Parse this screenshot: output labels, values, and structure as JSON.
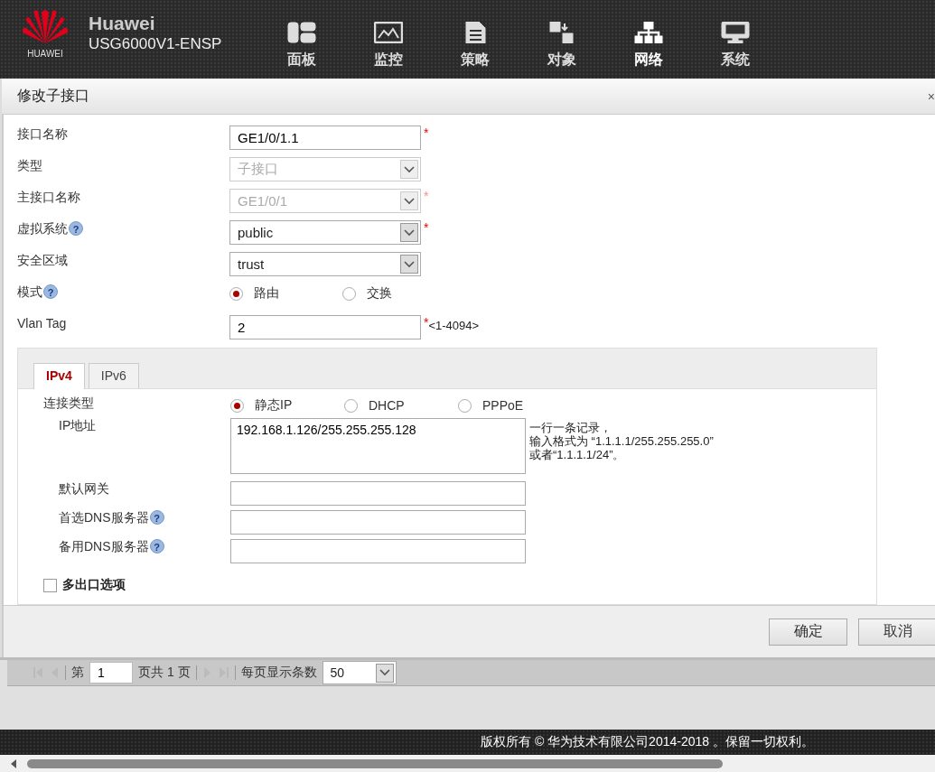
{
  "header": {
    "logo_text": "HUAWEI",
    "brand": "Huawei",
    "model": "USG6000V1-ENSP",
    "nav": [
      {
        "label": "面板",
        "selected": false
      },
      {
        "label": "监控",
        "selected": false
      },
      {
        "label": "策略",
        "selected": false
      },
      {
        "label": "对象",
        "selected": false
      },
      {
        "label": "网络",
        "selected": true
      },
      {
        "label": "系统",
        "selected": false
      }
    ]
  },
  "dialog": {
    "title": "修改子接口",
    "close": "×",
    "fields": [
      {
        "kind": "text",
        "label": "接口名称",
        "value": "GE1/0/1.1",
        "required": "*"
      },
      {
        "kind": "select",
        "label": "类型",
        "value": "子接口",
        "disabled": true
      },
      {
        "kind": "select",
        "label": "主接口名称",
        "value": "GE1/0/1",
        "disabled": true,
        "required": "*"
      },
      {
        "kind": "select",
        "label": "虚拟系统",
        "help": "?",
        "value": "public",
        "disabled": false,
        "required": "*"
      },
      {
        "kind": "select",
        "label": "安全区域",
        "value": "trust",
        "disabled": false
      },
      {
        "kind": "radio",
        "label": "模式",
        "help": "?",
        "options": [
          {
            "label": "路由",
            "selected": true
          },
          {
            "label": "交换",
            "selected": false
          }
        ]
      },
      {
        "kind": "text",
        "label": "Vlan Tag",
        "value": "2",
        "required": "*",
        "hint": "<1-4094>"
      }
    ],
    "tabs": [
      {
        "label": "IPv4",
        "selected": true
      },
      {
        "label": "IPv6",
        "selected": false
      }
    ],
    "connection_type": {
      "label": "连接类型",
      "options": [
        {
          "label": "静态IP",
          "selected": true
        },
        {
          "label": "DHCP",
          "selected": false
        },
        {
          "label": "PPPoE",
          "selected": false
        }
      ]
    },
    "ip_address": {
      "label": "IP地址",
      "value": "192.168.1.126/255.255.255.128",
      "hint": [
        "一行一条记录，",
        "输入格式为 “1.1.1.1/255.255.255.0”",
        "或者“1.1.1.1/24”。"
      ]
    },
    "ip_fields": [
      {
        "label": "默认网关"
      },
      {
        "label": "首选DNS服务器",
        "help": "?"
      },
      {
        "label": "备用DNS服务器",
        "help": "?"
      }
    ],
    "multi_exit": {
      "label": "多出口选项",
      "checked": false
    },
    "buttons": [
      "确定",
      "取消"
    ]
  },
  "pager": {
    "page_prefix": "第",
    "page": "1",
    "page_suffix": "页共 1 页",
    "per_page_label": "每页显示条数",
    "per_page": "50"
  },
  "footer": {
    "copyright": "版权所有 © 华为技术有限公司2014-2018 。保留一切权利。"
  }
}
